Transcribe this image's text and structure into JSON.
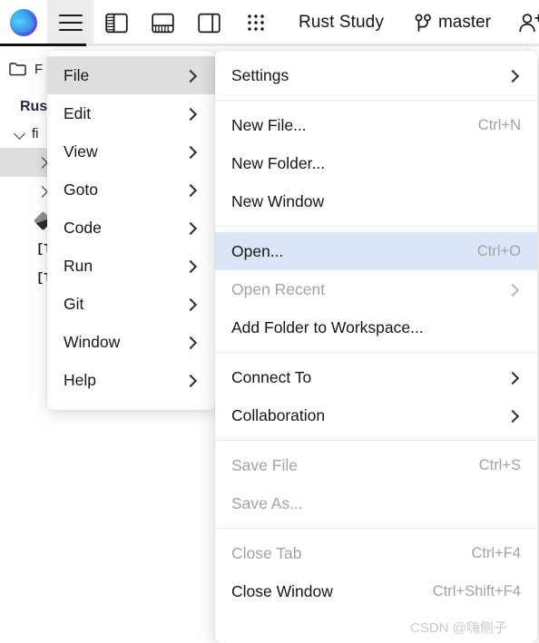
{
  "topbar": {
    "logo_name": "app-logo",
    "icons": [
      {
        "name": "hamburger-menu-icon",
        "label": "Menu",
        "active": true
      },
      {
        "name": "left-panel-icon",
        "label": "Toggle Left Panel",
        "active": false
      },
      {
        "name": "bottom-panel-icon",
        "label": "Toggle Bottom Panel",
        "active": false
      },
      {
        "name": "right-panel-icon",
        "label": "Toggle Right Panel",
        "active": false
      },
      {
        "name": "grid-apps-icon",
        "label": "Apps Grid",
        "active": false
      }
    ],
    "title": "Rust Study",
    "branch": "master",
    "branch_icon": "git-branch-icon",
    "adduser_icon": "add-user-icon"
  },
  "sidebar": {
    "header_label": "F",
    "header_icon": "folder-icon",
    "project": "Rus",
    "rows": [
      {
        "label": "fi",
        "icon": "chevron-down-icon",
        "selected": false
      },
      {
        "label": "",
        "icon": "chevron-right-icon",
        "selected": true
      },
      {
        "label": "",
        "icon": "chevron-right-icon",
        "selected": false
      },
      {
        "label": "",
        "icon": "diamond-file-icon",
        "selected": false
      },
      {
        "label": "[T",
        "icon": "toml-file-icon",
        "selected": false
      },
      {
        "label": "[T",
        "icon": "toml-file-icon",
        "selected": false
      }
    ]
  },
  "menu": {
    "items": [
      {
        "label": "File",
        "highlighted": true,
        "arrow": true
      },
      {
        "label": "Edit",
        "highlighted": false,
        "arrow": true
      },
      {
        "label": "View",
        "highlighted": false,
        "arrow": true
      },
      {
        "label": "Goto",
        "highlighted": false,
        "arrow": true
      },
      {
        "label": "Code",
        "highlighted": false,
        "arrow": true
      },
      {
        "label": "Run",
        "highlighted": false,
        "arrow": true
      },
      {
        "label": "Git",
        "highlighted": false,
        "arrow": true
      },
      {
        "label": "Window",
        "highlighted": false,
        "arrow": true
      },
      {
        "label": "Help",
        "highlighted": false,
        "arrow": true
      }
    ]
  },
  "submenu": {
    "groups": [
      {
        "items": [
          {
            "label": "Settings",
            "shortcut": "",
            "arrow": true,
            "disabled": false,
            "highlighted": false
          }
        ]
      },
      {
        "items": [
          {
            "label": "New File...",
            "shortcut": "Ctrl+N",
            "arrow": false,
            "disabled": false,
            "highlighted": false
          },
          {
            "label": "New Folder...",
            "shortcut": "",
            "arrow": false,
            "disabled": false,
            "highlighted": false
          },
          {
            "label": "New Window",
            "shortcut": "",
            "arrow": false,
            "disabled": false,
            "highlighted": false
          }
        ]
      },
      {
        "items": [
          {
            "label": "Open...",
            "shortcut": "Ctrl+O",
            "arrow": false,
            "disabled": false,
            "highlighted": true
          },
          {
            "label": "Open Recent",
            "shortcut": "",
            "arrow": true,
            "disabled": true,
            "highlighted": false
          },
          {
            "label": "Add Folder to Workspace...",
            "shortcut": "",
            "arrow": false,
            "disabled": false,
            "highlighted": false
          }
        ]
      },
      {
        "items": [
          {
            "label": "Connect To",
            "shortcut": "",
            "arrow": true,
            "disabled": false,
            "highlighted": false
          },
          {
            "label": "Collaboration",
            "shortcut": "",
            "arrow": true,
            "disabled": false,
            "highlighted": false
          }
        ]
      },
      {
        "items": [
          {
            "label": "Save File",
            "shortcut": "Ctrl+S",
            "arrow": false,
            "disabled": true,
            "highlighted": false
          },
          {
            "label": "Save As...",
            "shortcut": "",
            "arrow": false,
            "disabled": true,
            "highlighted": false
          }
        ]
      },
      {
        "items": [
          {
            "label": "Close Tab",
            "shortcut": "Ctrl+F4",
            "arrow": false,
            "disabled": true,
            "highlighted": false
          },
          {
            "label": "Close Window",
            "shortcut": "Ctrl+Shift+F4",
            "arrow": false,
            "disabled": false,
            "highlighted": false
          }
        ]
      }
    ]
  },
  "watermark": "CSDN @嗨侧子",
  "colors": {
    "menu_highlight": "#dedede",
    "submenu_highlight": "#dae6f8",
    "disabled_text": "#a2a2a8",
    "text": "#16161a",
    "project_text": "#1d2a4d",
    "active_tab_indicator": "#111114"
  }
}
